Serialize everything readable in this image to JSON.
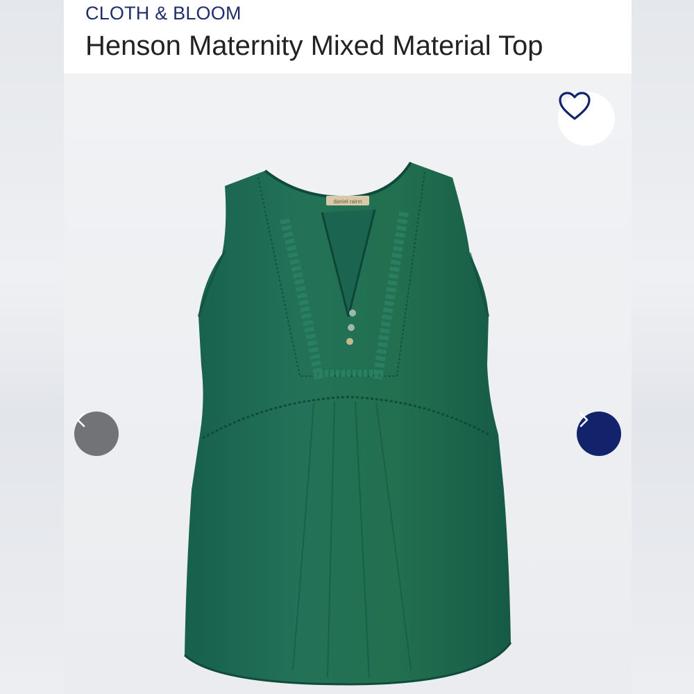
{
  "product": {
    "brand": "CLOTH & BLOOM",
    "title": "Henson Maternity Mixed Material Top",
    "image_alt": "Green sleeveless maternity top with crochet lace bib and button placket",
    "garment_label": "daniel rainn"
  },
  "controls": {
    "favorite_icon": "heart-outline-icon",
    "previous_icon": "chevron-left-icon",
    "next_icon": "chevron-right-icon"
  },
  "colors": {
    "brand_text": "#1f2e6b",
    "garment_green": "#1f6b55",
    "prev_button": "#727377",
    "next_button": "#13236b"
  }
}
